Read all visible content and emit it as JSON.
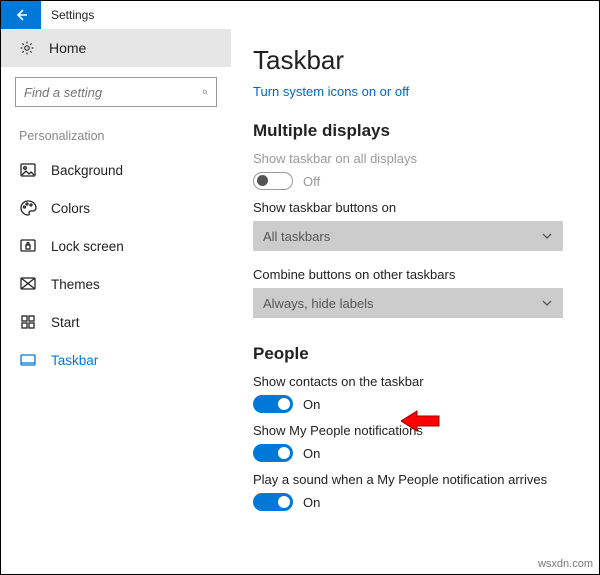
{
  "header": {
    "app_title": "Settings"
  },
  "sidebar": {
    "home_label": "Home",
    "search_placeholder": "Find a setting",
    "category_heading": "Personalization",
    "items": [
      {
        "label": "Background"
      },
      {
        "label": "Colors"
      },
      {
        "label": "Lock screen"
      },
      {
        "label": "Themes"
      },
      {
        "label": "Start"
      },
      {
        "label": "Taskbar"
      }
    ]
  },
  "page": {
    "title": "Taskbar",
    "link_sys_icons": "Turn system icons on or off",
    "section_displays": "Multiple displays",
    "show_all_displays_label": "Show taskbar on all displays",
    "off_text": "Off",
    "buttons_on_label": "Show taskbar buttons on",
    "buttons_on_value": "All taskbars",
    "combine_label": "Combine buttons on other taskbars",
    "combine_value": "Always, hide labels",
    "section_people": "People",
    "people_contacts_label": "Show contacts on the taskbar",
    "people_notif_label": "Show My People notifications",
    "people_sound_label": "Play a sound when a My People notification arrives",
    "on_text": "On"
  },
  "watermark": "wsxdn.com"
}
